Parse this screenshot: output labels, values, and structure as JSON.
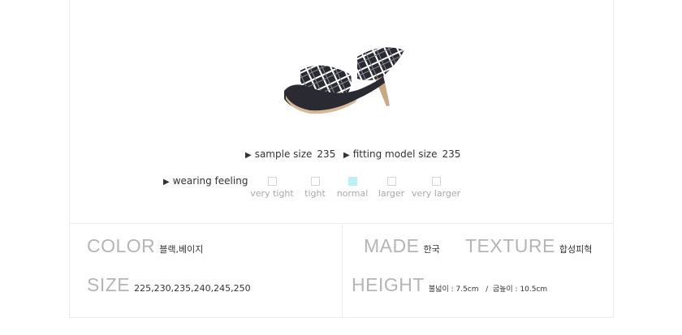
{
  "specs": {
    "sample_size_label": "sample size",
    "sample_size_value": "235",
    "fitting_model_label": "fitting model size",
    "fitting_model_value": "235",
    "triangle_glyph": "▶"
  },
  "wearing_feeling": {
    "label": "wearing feeling",
    "options": [
      "very tight",
      "tight",
      "normal",
      "larger",
      "very larger"
    ],
    "selected": "normal",
    "selected_color": "#b9f1f5"
  },
  "details": {
    "color_title": "COLOR",
    "color_value": "블랙,베이지",
    "size_title": "SIZE",
    "size_value": "225,230,235,240,245,250",
    "made_title": "MADE",
    "made_value": "한국",
    "texture_title": "TEXTURE",
    "texture_value": "합성피혁",
    "height_title": "HEIGHT",
    "height_value": "불넓이 : 7.5cm   /  굽높이 : 10.5cm"
  },
  "product_image": {
    "icon": "plaid-platform-heel-sandal",
    "pattern_colors": [
      "#2a2a33",
      "#ffffff",
      "#8a8a95"
    ]
  }
}
